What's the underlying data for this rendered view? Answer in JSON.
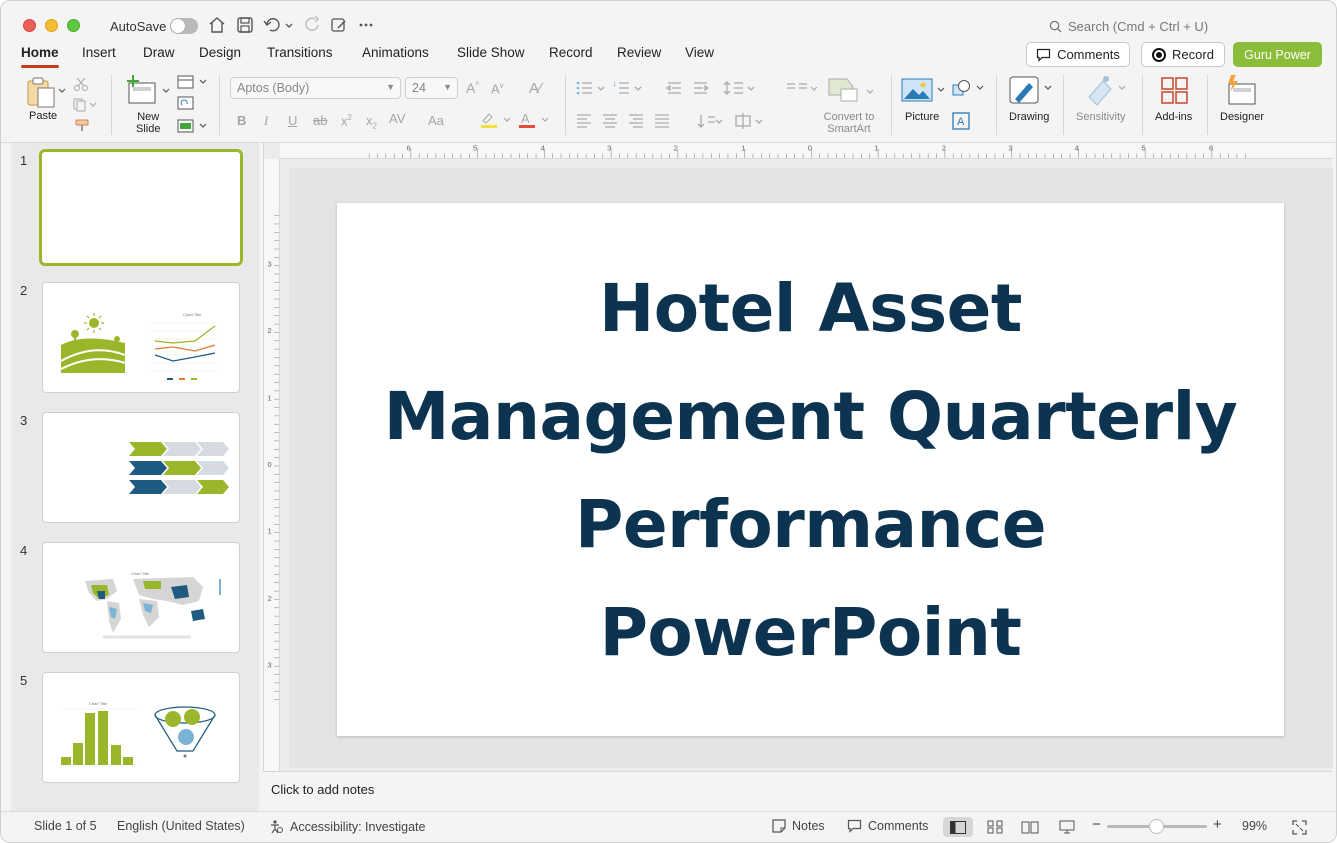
{
  "titlebar": {
    "autosave_label": "AutoSave",
    "search_placeholder": "Search (Cmd + Ctrl + U)"
  },
  "tabs": [
    {
      "label": "Home",
      "active": true
    },
    {
      "label": "Insert"
    },
    {
      "label": "Draw"
    },
    {
      "label": "Design"
    },
    {
      "label": "Transitions"
    },
    {
      "label": "Animations"
    },
    {
      "label": "Slide Show"
    },
    {
      "label": "Record"
    },
    {
      "label": "Review"
    },
    {
      "label": "View"
    }
  ],
  "header_buttons": {
    "comments": "Comments",
    "record": "Record",
    "guru": "Guru Power"
  },
  "ribbon": {
    "paste": "Paste",
    "new_slide": "New\nSlide",
    "font_name": "Aptos (Body)",
    "font_size": "24",
    "convert_smartart": "Convert to\nSmartArt",
    "picture": "Picture",
    "drawing": "Drawing",
    "sensitivity": "Sensitivity",
    "addins": "Add-ins",
    "designer": "Designer"
  },
  "thumbnails": [
    {
      "number": "1",
      "selected": true
    },
    {
      "number": "2",
      "chart_title": "Chart Title"
    },
    {
      "number": "3"
    },
    {
      "number": "4",
      "chart_title": "Chart Title"
    },
    {
      "number": "5",
      "chart_title": "Chart Title"
    }
  ],
  "slide": {
    "title": "Hotel Asset Management Quarterly Performance PowerPoint"
  },
  "ruler": {
    "h_labels": [
      "6",
      "5",
      "4",
      "3",
      "2",
      "1",
      "0",
      "1",
      "2",
      "3",
      "4",
      "5",
      "6"
    ],
    "v_labels": [
      "3",
      "2",
      "1",
      "0",
      "1",
      "2",
      "3"
    ]
  },
  "notes": {
    "placeholder": "Click to add notes"
  },
  "status": {
    "slide_info": "Slide 1 of 5",
    "language": "English (United States)",
    "accessibility": "Accessibility: Investigate",
    "notes": "Notes",
    "comments": "Comments",
    "zoom": "99%"
  },
  "colors": {
    "accent_green": "#9ab72b",
    "title_navy": "#0c3450",
    "tab_underline": "#c43e1c",
    "guru_button": "#8bbd3a"
  }
}
